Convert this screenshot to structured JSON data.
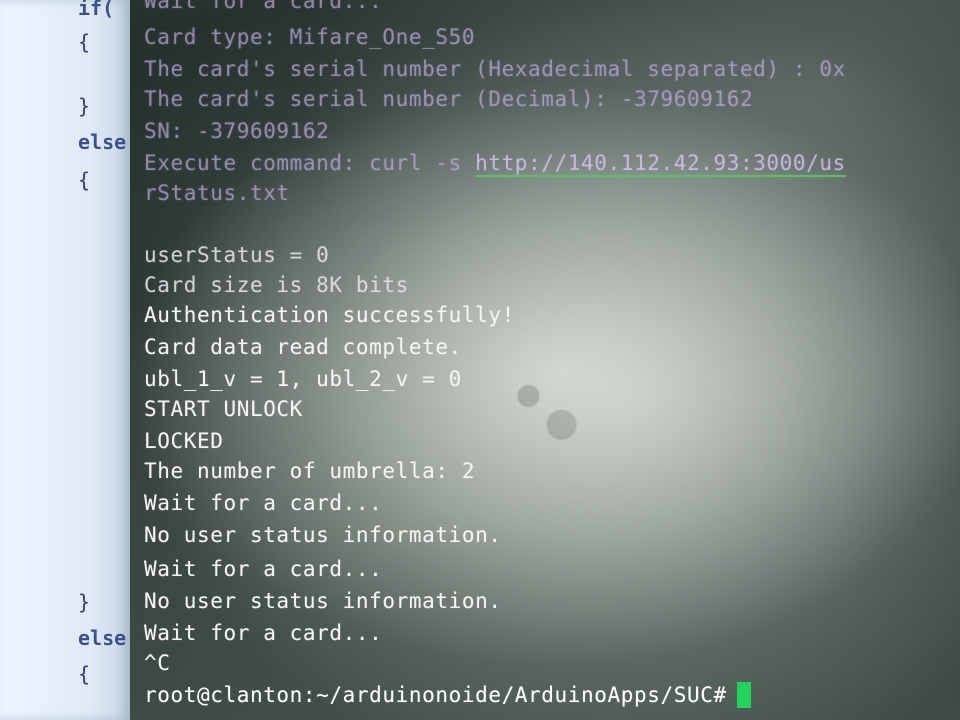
{
  "editor": {
    "lines": [
      "if(",
      "{",
      "}",
      "else",
      "{",
      "}",
      "else",
      "{"
    ]
  },
  "terminal": {
    "lines": [
      "Wait for a card...",
      "Card type: Mifare_One_S50",
      "The card's serial number (Hexadecimal separated) : 0x",
      "The card's serial number (Decimal): -379609162",
      "SN: -379609162",
      "Execute command: curl -s ",
      "rStatus.txt",
      "userStatus = 0",
      "Card size is 8K bits",
      "Authentication successfully!",
      "Card data read complete.",
      "ubl_1_v = 1, ubl_2_v = 0",
      "START UNLOCK",
      "LOCKED",
      "The number of umbrella: 2",
      "Wait for a card...",
      "No user status information.",
      "Wait for a card...",
      "No user status information.",
      "Wait for a card...",
      "^C"
    ],
    "url": "http://140.112.42.93:3000/us",
    "prompt": "root@clanton:~/arduinonoide/ArduinoApps/SUC#"
  },
  "colors": {
    "terminal_text": "#f4f4f2",
    "faded_text": "#c4b8e2",
    "cursor": "#22d35b",
    "url_underline": "#58c25a",
    "editor_text": "#2b3d82"
  }
}
